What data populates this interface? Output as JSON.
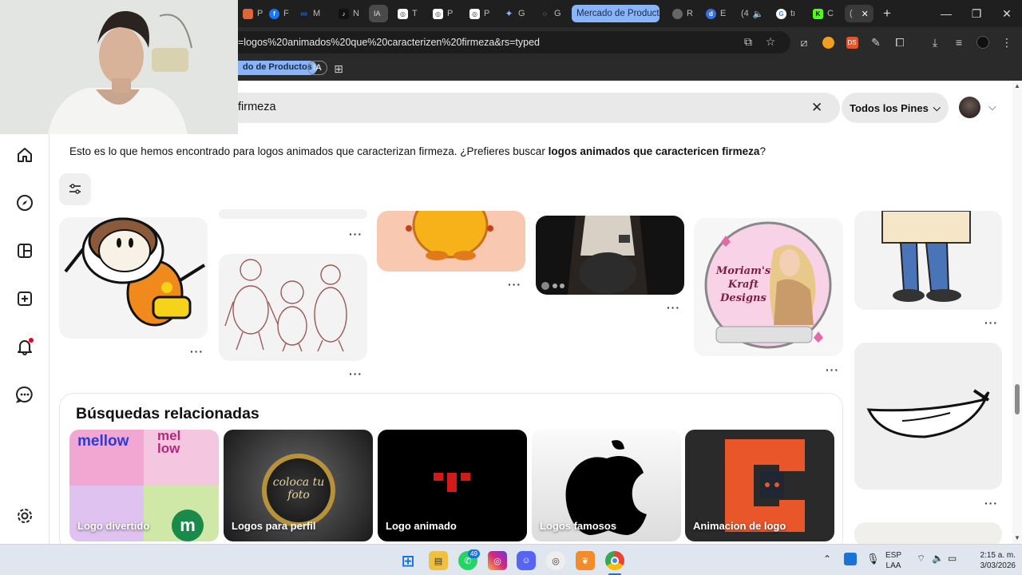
{
  "browser": {
    "tabs": [
      {
        "label": "P",
        "icon": "pinterest-icon",
        "color": "#e60023"
      },
      {
        "label": "F",
        "icon": "facebook-icon",
        "color": "#1877f2"
      },
      {
        "label": "M",
        "icon": "meta-icon",
        "color": "#0866ff"
      },
      {
        "label": "N",
        "icon": "tiktok-icon",
        "color": "#111111"
      },
      {
        "label": "IA",
        "icon": "ia-icon",
        "color": "#5f6368"
      },
      {
        "label": "T",
        "icon": "openai-icon",
        "color": "#444444"
      },
      {
        "label": "P",
        "icon": "openai-icon",
        "color": "#444444"
      },
      {
        "label": "P",
        "icon": "openai-icon",
        "color": "#444444"
      },
      {
        "label": "G",
        "icon": "gemini-icon",
        "color": "#4285f4"
      },
      {
        "label": "G",
        "icon": "loader-icon",
        "color": "#333333"
      }
    ],
    "tab_group": "Mercado de Producto",
    "tabs_after": [
      {
        "label": "R",
        "icon": "compass-icon"
      },
      {
        "label": "E",
        "icon": "d-icon"
      },
      {
        "label": "(4",
        "icon": "audio-icon"
      },
      {
        "label": "tı",
        "icon": "google-icon"
      },
      {
        "label": "C",
        "icon": "kick-icon"
      },
      {
        "label": "(",
        "icon": "active-tab-icon"
      }
    ],
    "url": "=logos%20animados%20que%20caracterizen%20firmeza&rs=typed",
    "bookmarks": {
      "group_label": "do de Productos",
      "ia_label": "IA"
    }
  },
  "search": {
    "query": "firmeza",
    "filter_label": "Todos los Pines"
  },
  "notice": {
    "prefix": "Esto es lo que hemos encontrado para logos animados que caracterizan firmeza. ¿Prefieres buscar ",
    "suggestion": "logos animados que caractericen firmeza",
    "suffix": "?"
  },
  "pins": {
    "more_label": "···",
    "logo_text_1": "Moriam's",
    "logo_text_2": "Kraft",
    "logo_text_3": "Designs"
  },
  "related": {
    "title": "Búsquedas relacionadas",
    "cards": [
      {
        "label": "Logo divertido",
        "text_top": "mellow",
        "text_side": "mel low"
      },
      {
        "label": "Logos para perfil",
        "text_center": "coloca tu foto"
      },
      {
        "label": "Logo animado"
      },
      {
        "label": "Logos famosos"
      },
      {
        "label": "Animacion de logo"
      }
    ]
  },
  "taskbar": {
    "whatsapp_badge": "49",
    "lang_top": "ESP",
    "lang_bottom": "LAA",
    "time": "2:15 a. m.",
    "date": "3/03/2026"
  }
}
